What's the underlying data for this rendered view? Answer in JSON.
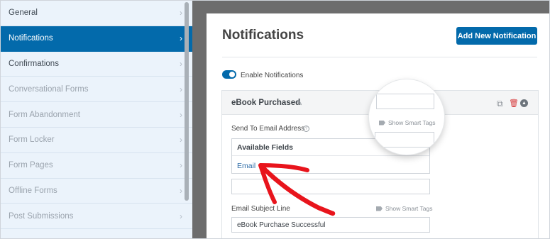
{
  "sidebar": {
    "items": [
      {
        "label": "General",
        "state": "normal"
      },
      {
        "label": "Notifications",
        "state": "active"
      },
      {
        "label": "Confirmations",
        "state": "normal"
      },
      {
        "label": "Conversational Forms",
        "state": "disabled"
      },
      {
        "label": "Form Abandonment",
        "state": "disabled"
      },
      {
        "label": "Form Locker",
        "state": "disabled"
      },
      {
        "label": "Form Pages",
        "state": "disabled"
      },
      {
        "label": "Offline Forms",
        "state": "disabled"
      },
      {
        "label": "Post Submissions",
        "state": "disabled"
      }
    ],
    "chevron": "›"
  },
  "header": {
    "title": "Notifications",
    "add_button": "Add New Notification"
  },
  "toggle": {
    "label": "Enable Notifications",
    "on": true
  },
  "notification": {
    "title": "eBook Purchased",
    "pencil": "✎",
    "copy": "⧉",
    "trash": "🗑",
    "collapse": "▲"
  },
  "send_to": {
    "label": "Send To Email Address",
    "help": "?",
    "dropdown_header": "Available Fields",
    "dropdown_option": "Email"
  },
  "subject": {
    "label": "Email Subject Line",
    "smart_tags": "Show Smart Tags",
    "value": "eBook Purchase Successful"
  },
  "magnifier": {
    "smart_tags": "Show Smart Tags"
  },
  "colors": {
    "accent": "#036aab",
    "annotation_arrow": "#e8141c"
  }
}
